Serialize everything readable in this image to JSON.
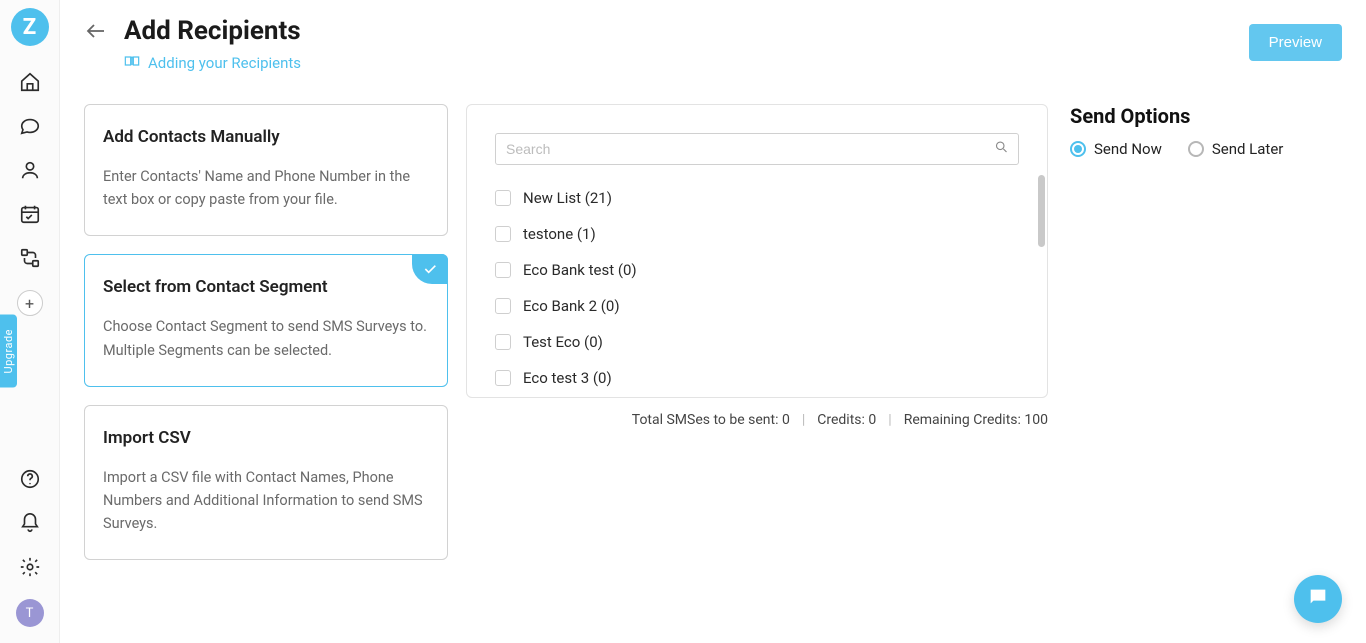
{
  "sidebar": {
    "logo_letter": "Z",
    "upgrade_label": "Upgrade",
    "avatar_letter": "T"
  },
  "header": {
    "title": "Add Recipients",
    "helper_link": "Adding your Recipients",
    "preview_button": "Preview"
  },
  "cards": {
    "manual": {
      "title": "Add Contacts Manually",
      "desc": "Enter Contacts' Name and Phone Number in the text box or copy paste from your file."
    },
    "segment": {
      "title": "Select from Contact Segment",
      "desc": "Choose Contact Segment to send SMS Surveys to. Multiple Segments can be selected."
    },
    "import": {
      "title": "Import CSV",
      "desc": "Import a CSV file with Contact Names, Phone Numbers and Additional Information to send SMS Surveys."
    }
  },
  "segment_panel": {
    "search_placeholder": "Search",
    "items": [
      "New List (21)",
      "testone (1)",
      "Eco Bank test (0)",
      "Eco Bank 2 (0)",
      "Test Eco (0)",
      "Eco test 3 (0)"
    ]
  },
  "stats": {
    "total_sms_label": "Total SMSes to be sent:",
    "total_sms_value": "0",
    "credits_label": "Credits:",
    "credits_value": "0",
    "remaining_label": "Remaining Credits:",
    "remaining_value": "100"
  },
  "send_options": {
    "title": "Send Options",
    "now": "Send Now",
    "later": "Send Later"
  }
}
